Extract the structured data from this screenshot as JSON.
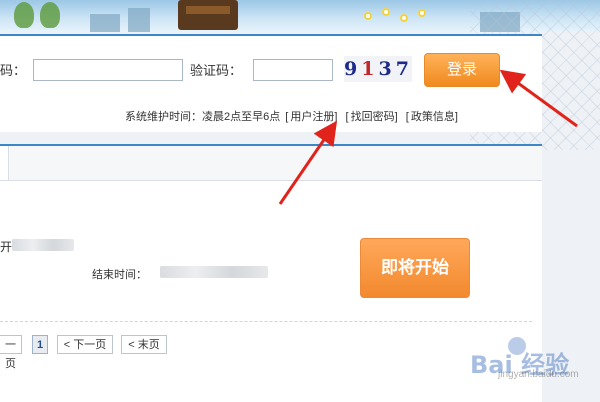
{
  "login": {
    "username_label_partial": "码：",
    "captcha_label": "验证码：",
    "captcha_text": {
      "a": "9",
      "b": "1",
      "c": "3",
      "d": "7"
    },
    "login_button": "登录"
  },
  "links": {
    "maintenance": "系统维护时间：凌晨2点至早6点",
    "register": "用户注册",
    "forgot": "找回密码",
    "policy": "政策信息",
    "bracket_open": "[",
    "bracket_close": "]"
  },
  "event": {
    "title_partial": "开",
    "end_label": "结束时间：",
    "start_button": "即将开始"
  },
  "pagination": {
    "prev": "一页",
    "current": "1",
    "next": "< 下一页",
    "last": "< 末页"
  },
  "watermark": {
    "logo": "Bai 经验",
    "url": "jingyan.baidu.com"
  },
  "colors": {
    "accent_blue": "#3c87c8",
    "orange": "#f08a1c",
    "arrow_red": "#e0241b"
  }
}
